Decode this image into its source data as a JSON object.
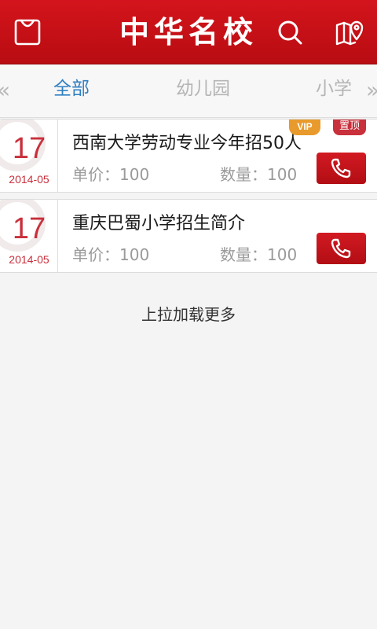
{
  "header": {
    "title": "中华名校",
    "icons": [
      "bag-icon",
      "search-icon",
      "map-location-icon"
    ]
  },
  "tabs": {
    "left_arrow": "«",
    "right_arrow": "»",
    "items": [
      {
        "label": "全部",
        "active": true
      },
      {
        "label": "幼儿园",
        "active": false
      },
      {
        "label": "小学",
        "active": false
      }
    ]
  },
  "list": [
    {
      "day": "17",
      "year_month": "2014-05",
      "title": "西南大学劳动专业今年招50人",
      "price": "单价：100",
      "quantity": "数量：100",
      "badge_vip": "VIP",
      "badge_top": "置顶"
    },
    {
      "day": "17",
      "year_month": "2014-05",
      "title": "重庆巴蜀小学招生简介",
      "price": "单价：100",
      "quantity": "数量：100"
    }
  ],
  "footer": {
    "load_more": "上拉加载更多"
  },
  "colors": {
    "brand_red": "#c8141c",
    "tab_active": "#2f7fc2",
    "vip_orange": "#e89a2c"
  }
}
